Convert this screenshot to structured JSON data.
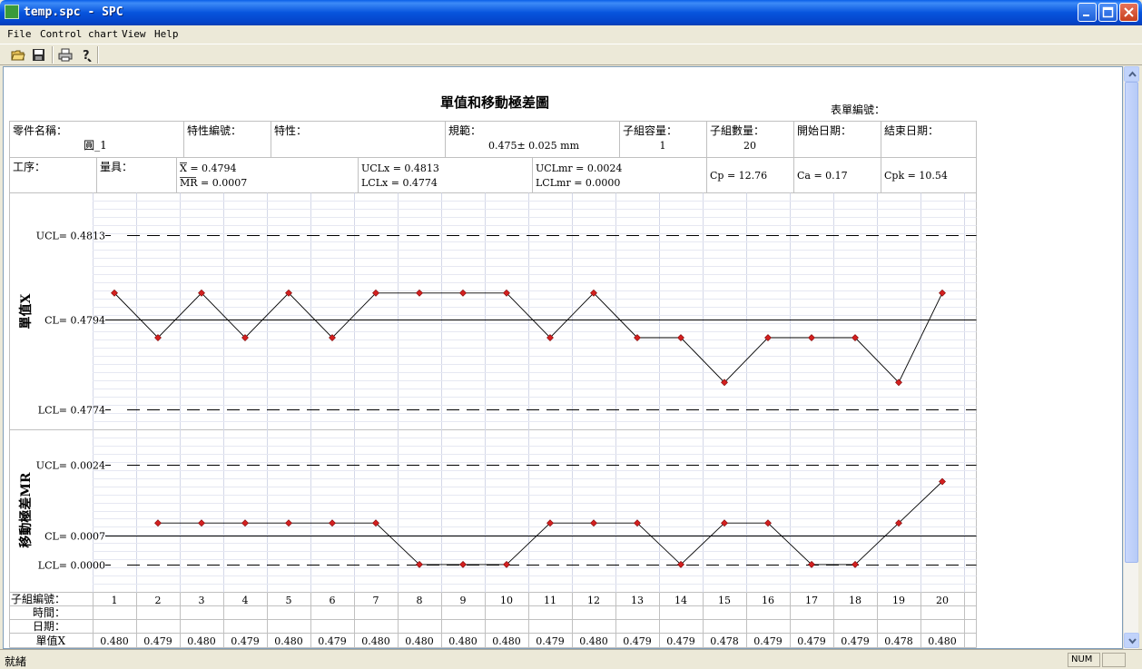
{
  "window": {
    "title": "temp.spc - SPC"
  },
  "menu": {
    "items": [
      "File",
      "Control chart",
      "View",
      "Help"
    ]
  },
  "toolbar": {
    "icons": [
      "open-folder-icon",
      "save-icon",
      "print-icon",
      "help-icon"
    ]
  },
  "status": {
    "text": "就緒",
    "num": "NUM"
  },
  "report": {
    "title": "單值和移動極差圖",
    "form_no_label": "表單編號：",
    "row1": {
      "part_name_label": "零件名稱：",
      "part_name": "圓_1",
      "char_no_label": "特性編號：",
      "char_label": "特性：",
      "spec_label": "規範：",
      "spec": "0.475± 0.025 mm",
      "subgroup_size_label": "子組容量：",
      "subgroup_size": "1",
      "subgroup_count_label": "子組數量：",
      "subgroup_count": "20",
      "start_date_label": "開始日期：",
      "end_date_label": "結束日期："
    },
    "row2": {
      "process_label": "工序：",
      "gauge_label": "量具：",
      "xbar": "X =  0.4794",
      "mr": "MR =  0.0007",
      "uclx": "UCLx =  0.4813",
      "lclx": "LCLx =  0.4774",
      "uclmr": "UCLmr =  0.0024",
      "lclmr": "LCLmr =  0.0000",
      "cp": "Cp = 12.76",
      "ca": "Ca = 0.17",
      "cpk": "Cpk = 10.54"
    },
    "table_labels": {
      "subgroup": "子組編號：",
      "time": "時間：",
      "date": "日期：",
      "value": "單值X"
    }
  },
  "chart_data": [
    {
      "type": "line",
      "ylabel": "單值X",
      "x": [
        1,
        2,
        3,
        4,
        5,
        6,
        7,
        8,
        9,
        10,
        11,
        12,
        13,
        14,
        15,
        16,
        17,
        18,
        19,
        20
      ],
      "values": [
        0.48,
        0.479,
        0.48,
        0.479,
        0.48,
        0.479,
        0.48,
        0.48,
        0.48,
        0.48,
        0.479,
        0.48,
        0.479,
        0.479,
        0.478,
        0.479,
        0.479,
        0.479,
        0.478,
        0.48
      ],
      "value_labels": [
        "0.480",
        "0.479",
        "0.480",
        "0.479",
        "0.480",
        "0.479",
        "0.480",
        "0.480",
        "0.480",
        "0.480",
        "0.479",
        "0.480",
        "0.479",
        "0.479",
        "0.478",
        "0.479",
        "0.479",
        "0.479",
        "0.478",
        "0.480"
      ],
      "ucl": 0.4813,
      "cl": 0.4794,
      "lcl": 0.4774,
      "ucl_label": "UCL= 0.4813",
      "cl_label": "CL= 0.4794",
      "lcl_label": "LCL= 0.4774",
      "ylim": [
        0.47695,
        0.48225
      ]
    },
    {
      "type": "line",
      "ylabel": "移動極差MR",
      "x": [
        2,
        3,
        4,
        5,
        6,
        7,
        8,
        9,
        10,
        11,
        12,
        13,
        14,
        15,
        16,
        17,
        18,
        19,
        20
      ],
      "values": [
        0.001,
        0.001,
        0.001,
        0.001,
        0.001,
        0.001,
        0.0,
        0.0,
        0.0,
        0.001,
        0.001,
        0.001,
        0.0,
        0.001,
        0.001,
        0.0,
        0.0,
        0.001,
        0.002
      ],
      "ucl": 0.0024,
      "cl": 0.0007,
      "lcl": 0.0,
      "ucl_label": "UCL= 0.0024",
      "cl_label": "CL= 0.0007",
      "lcl_label": "LCL= 0.0000",
      "ylim": [
        -0.00066,
        0.00326
      ]
    }
  ]
}
